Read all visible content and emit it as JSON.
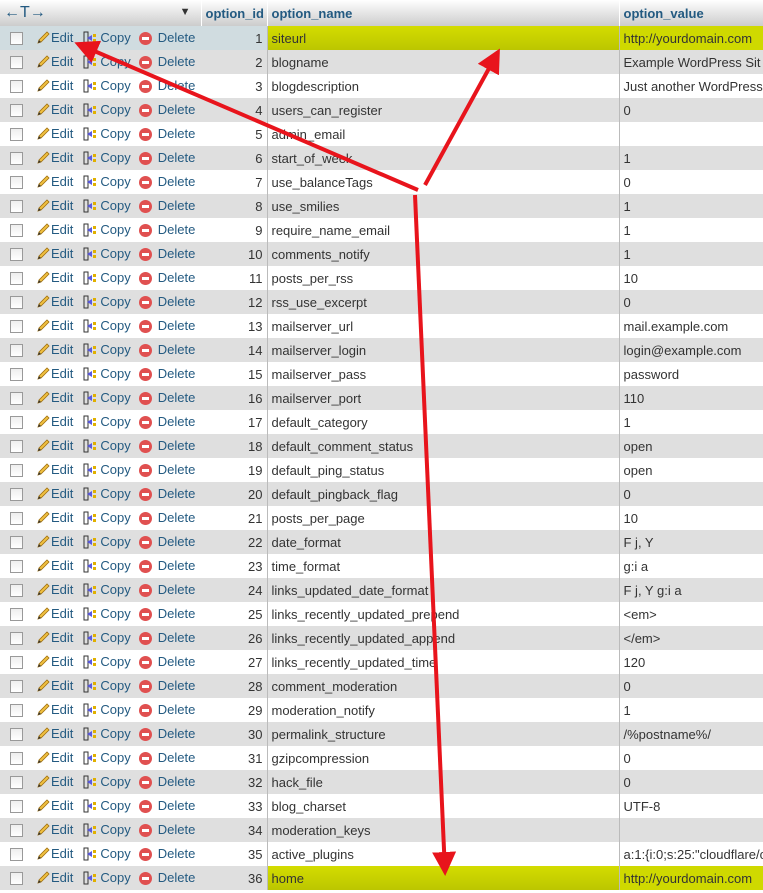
{
  "header": {
    "nav": "←T→",
    "option_id": "option_id",
    "option_name": "option_name",
    "option_value": "option_value"
  },
  "actions": {
    "edit": "Edit",
    "copy": "Copy",
    "delete": "Delete"
  },
  "rows": [
    {
      "id": "1",
      "name": "siteurl",
      "value": "http://yourdomain.com"
    },
    {
      "id": "2",
      "name": "blogname",
      "value": "Example WordPress Sit"
    },
    {
      "id": "3",
      "name": "blogdescription",
      "value": "Just another WordPress"
    },
    {
      "id": "4",
      "name": "users_can_register",
      "value": "0"
    },
    {
      "id": "5",
      "name": "admin_email",
      "value": ""
    },
    {
      "id": "6",
      "name": "start_of_week",
      "value": "1"
    },
    {
      "id": "7",
      "name": "use_balanceTags",
      "value": "0"
    },
    {
      "id": "8",
      "name": "use_smilies",
      "value": "1"
    },
    {
      "id": "9",
      "name": "require_name_email",
      "value": "1"
    },
    {
      "id": "10",
      "name": "comments_notify",
      "value": "1"
    },
    {
      "id": "11",
      "name": "posts_per_rss",
      "value": "10"
    },
    {
      "id": "12",
      "name": "rss_use_excerpt",
      "value": "0"
    },
    {
      "id": "13",
      "name": "mailserver_url",
      "value": "mail.example.com"
    },
    {
      "id": "14",
      "name": "mailserver_login",
      "value": "login@example.com"
    },
    {
      "id": "15",
      "name": "mailserver_pass",
      "value": "password"
    },
    {
      "id": "16",
      "name": "mailserver_port",
      "value": "110"
    },
    {
      "id": "17",
      "name": "default_category",
      "value": "1"
    },
    {
      "id": "18",
      "name": "default_comment_status",
      "value": "open"
    },
    {
      "id": "19",
      "name": "default_ping_status",
      "value": "open"
    },
    {
      "id": "20",
      "name": "default_pingback_flag",
      "value": "0"
    },
    {
      "id": "21",
      "name": "posts_per_page",
      "value": "10"
    },
    {
      "id": "22",
      "name": "date_format",
      "value": "F j, Y"
    },
    {
      "id": "23",
      "name": "time_format",
      "value": "g:i a"
    },
    {
      "id": "24",
      "name": "links_updated_date_format",
      "value": "F j, Y g:i a"
    },
    {
      "id": "25",
      "name": "links_recently_updated_prepend",
      "value": "<em>"
    },
    {
      "id": "26",
      "name": "links_recently_updated_append",
      "value": "</em>"
    },
    {
      "id": "27",
      "name": "links_recently_updated_time",
      "value": "120"
    },
    {
      "id": "28",
      "name": "comment_moderation",
      "value": "0"
    },
    {
      "id": "29",
      "name": "moderation_notify",
      "value": "1"
    },
    {
      "id": "30",
      "name": "permalink_structure",
      "value": "/%postname%/"
    },
    {
      "id": "31",
      "name": "gzipcompression",
      "value": "0"
    },
    {
      "id": "32",
      "name": "hack_file",
      "value": "0"
    },
    {
      "id": "33",
      "name": "blog_charset",
      "value": "UTF-8"
    },
    {
      "id": "34",
      "name": "moderation_keys",
      "value": ""
    },
    {
      "id": "35",
      "name": "active_plugins",
      "value": "a:1:{i:0;s:25:\"cloudflare/c"
    },
    {
      "id": "36",
      "name": "home",
      "value": "http://yourdomain.com"
    }
  ],
  "highlighted_ids": [
    "1",
    "36"
  ],
  "annotation_color": "#e8141c"
}
